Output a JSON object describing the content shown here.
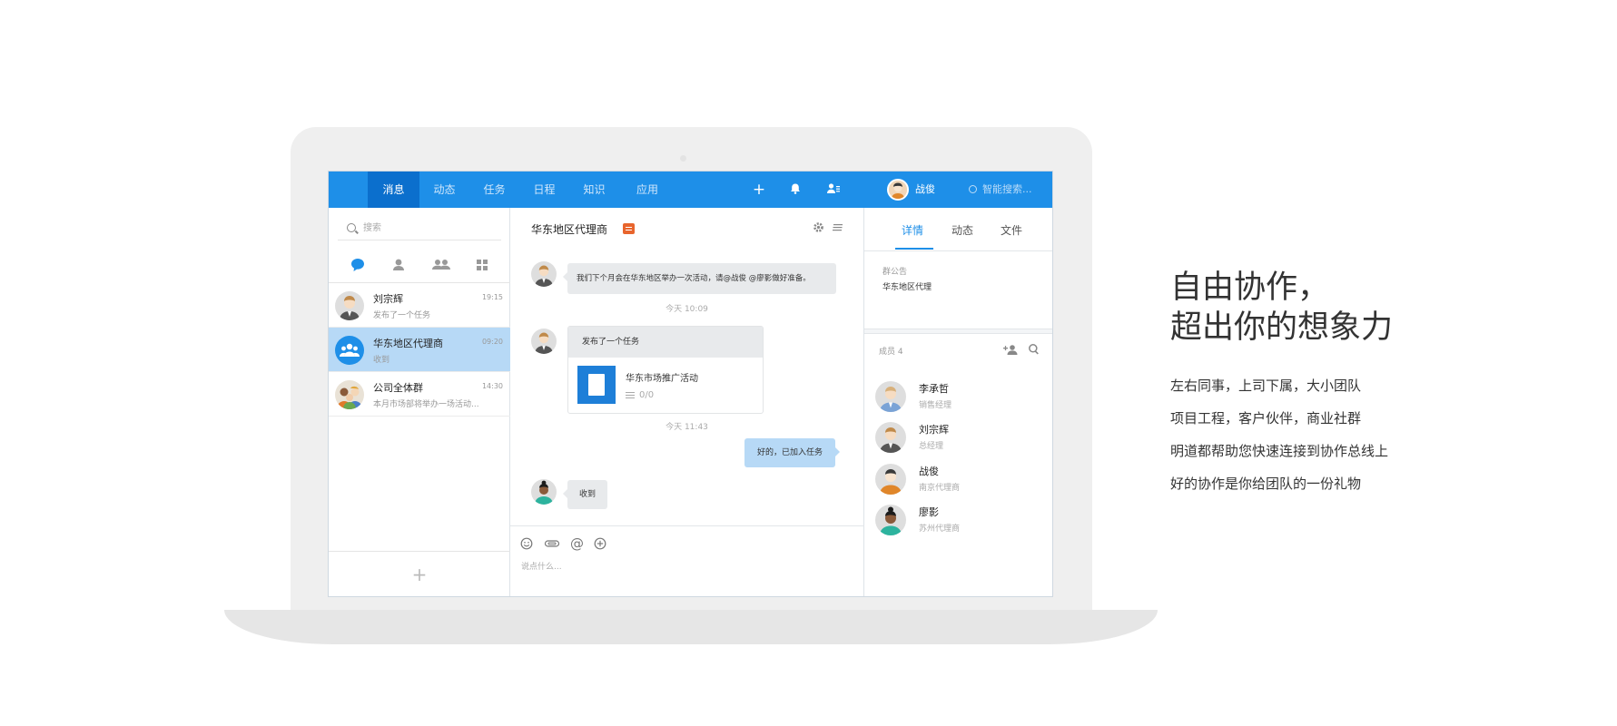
{
  "nav": {
    "tabs": [
      "消息",
      "动态",
      "任务",
      "日程",
      "知识",
      "应用"
    ],
    "user_name": "战俊",
    "search_placeholder": "智能搜索..."
  },
  "left": {
    "search_placeholder": "搜索",
    "conversations": [
      {
        "name": "刘宗辉",
        "time": "19:15",
        "preview": "发布了一个任务"
      },
      {
        "name": "华东地区代理商",
        "time": "09:20",
        "preview": "收到"
      },
      {
        "name": "公司全体群",
        "time": "14:30",
        "preview": "本月市场部将举办一场活动..."
      }
    ],
    "add_label": "+"
  },
  "chat": {
    "title": "华东地区代理商",
    "message1": "我们下个月会在华东地区举办一次活动，请@战俊 @廖影做好准备。",
    "time1": "今天 10:09",
    "task_header": "发布了一个任务",
    "task_name": "华东市场推广活动",
    "task_progress": "0/0",
    "time2": "今天 11:43",
    "reply_mine": "好的，已加入任务",
    "reply_other": "收到",
    "composer_placeholder": "说点什么..."
  },
  "details": {
    "tabs": [
      "详情",
      "动态",
      "文件"
    ],
    "announcement_label": "群公告",
    "announcement_text": "华东地区代理",
    "members_label": "成员 4",
    "members": [
      {
        "name": "李承哲",
        "role": "销售经理"
      },
      {
        "name": "刘宗辉",
        "role": "总经理"
      },
      {
        "name": "战俊",
        "role": "南京代理商"
      },
      {
        "name": "廖影",
        "role": "苏州代理商"
      }
    ]
  },
  "marketing": {
    "headline_1": "自由协作，",
    "headline_2": "超出你的想象力",
    "lines": [
      "左右同事，上司下属，大小团队",
      "项目工程，客户伙伴，商业社群",
      "明道都帮助您快速连接到协作总线上",
      "好的协作是你给团队的一份礼物"
    ]
  },
  "colors": {
    "brand_blue": "#1e8fe8",
    "active_tab": "#0b6fcd",
    "selected_row": "#b7d9f6",
    "tag_orange": "#e8652d"
  }
}
